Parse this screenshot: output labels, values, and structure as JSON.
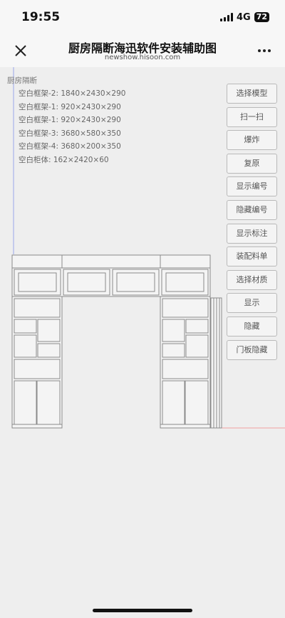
{
  "status_bar": {
    "time": "19:55",
    "network": "4G",
    "battery": "72"
  },
  "nav": {
    "title": "厨房隔断海迅软件安装辅助图",
    "subtitle": "newshow.hisoon.com"
  },
  "scene": {
    "root_label": "厨房隔断",
    "items": [
      "空白框架-2: 1840×2430×290",
      "空白框架-1: 920×2430×290",
      "空白框架-1: 920×2430×290",
      "空白框架-3: 3680×580×350",
      "空白框架-4: 3680×200×350",
      "空白柜体: 162×2420×60"
    ]
  },
  "toolbar": {
    "buttons": [
      "选择模型",
      "扫一扫",
      "爆炸",
      "复原",
      "显示编号",
      "隐藏编号",
      "显示标注",
      "装配料单",
      "选择材质",
      "显示",
      "隐藏",
      "门板隐藏"
    ]
  }
}
